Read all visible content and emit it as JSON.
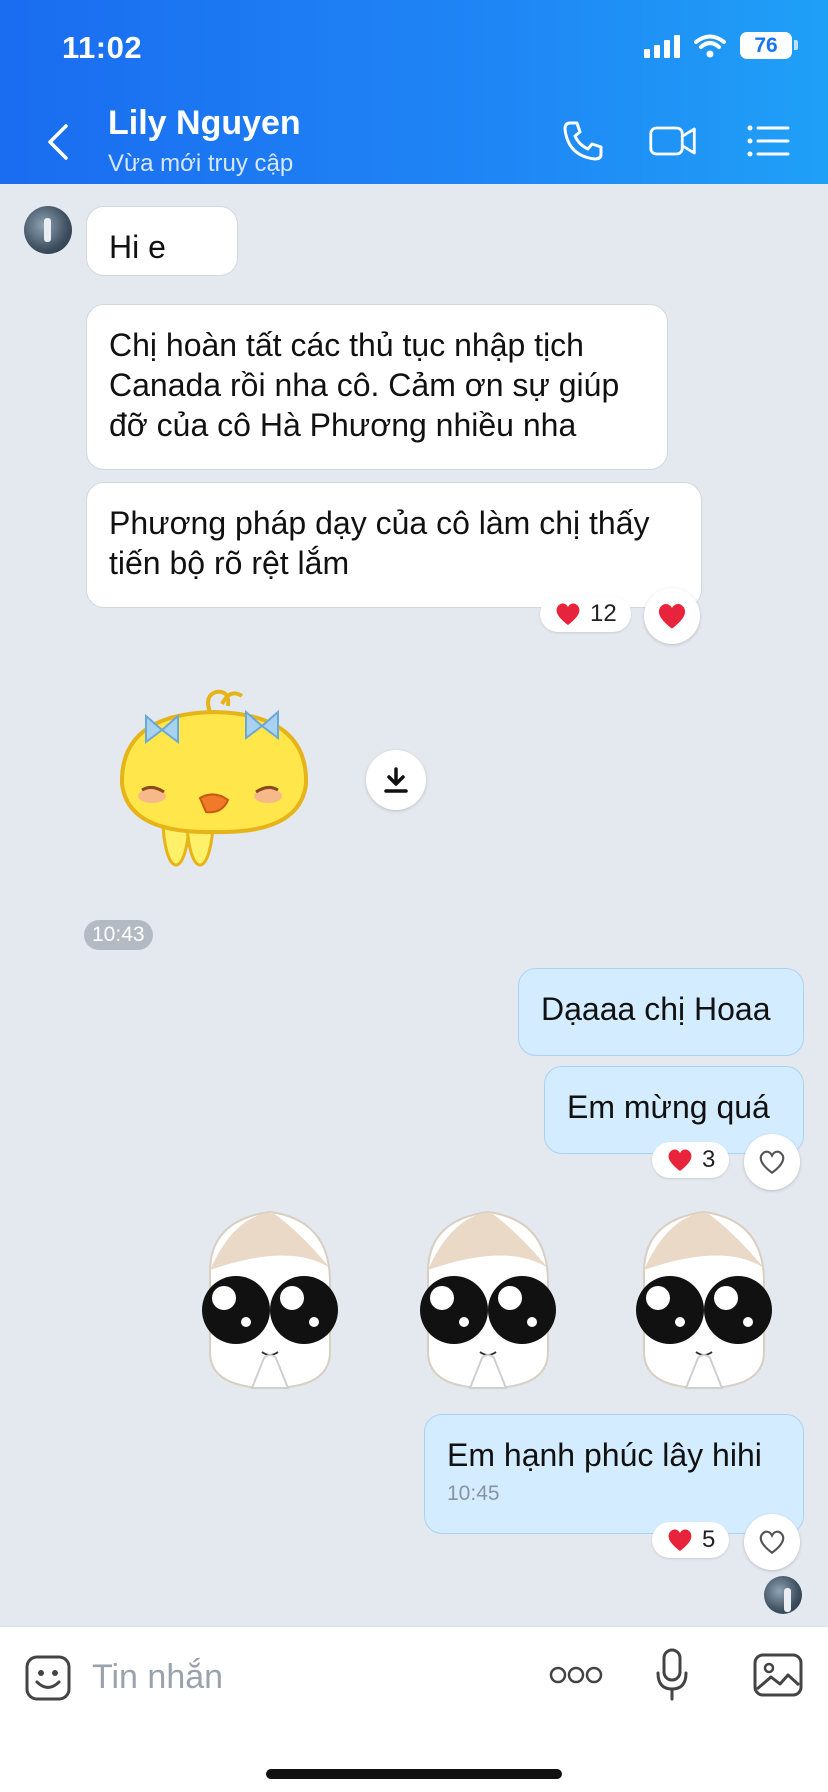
{
  "status_bar": {
    "time": "11:02",
    "battery": "76"
  },
  "header": {
    "contact_name": "Lily Nguyen",
    "contact_status": "Vừa mới truy cập"
  },
  "messages": {
    "m1": "Hi e",
    "m2": "Chị hoàn tất các thủ tục nhập tịch Canada rồi nha cô. Cảm ơn sự giúp đỡ của cô Hà Phương nhiều nha",
    "m3": "Phương pháp dạy của cô làm chị thấy tiến bộ rõ rệt lắm",
    "m3_reaction_count": "12",
    "sticker_time": "10:43",
    "m4": "Dạaaa chị Hoaa",
    "m5": "Em mừng quá",
    "m5_reaction_count": "3",
    "m6": "Em hạnh phúc lây hihi",
    "m6_time": "10:45",
    "m6_reaction_count": "5"
  },
  "input": {
    "placeholder": "Tin nhắn"
  },
  "colors": {
    "header_start": "#1a6cf0",
    "header_end": "#1fa0f7",
    "outgoing_bubble": "#d4ecff",
    "chat_bg": "#e4e8ef",
    "heart": "#e8243c"
  },
  "icons": [
    "back-icon",
    "phone-icon",
    "video-call-icon",
    "menu-list-icon",
    "heart-icon",
    "download-icon",
    "emoji-icon",
    "more-icon",
    "microphone-icon",
    "image-icon"
  ]
}
